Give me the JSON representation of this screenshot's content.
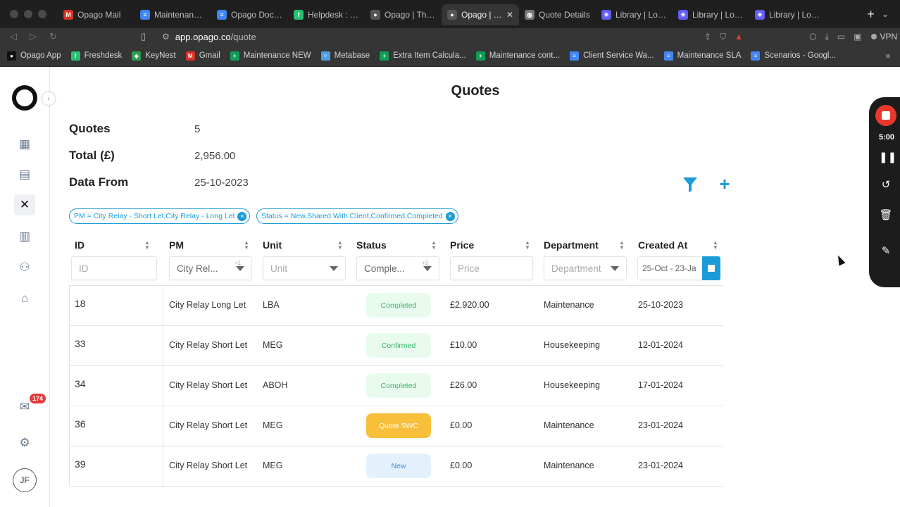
{
  "browser": {
    "tabs": [
      {
        "title": "Opago Mail",
        "icon": "gmail-icon",
        "color": "#d93025",
        "glyph": "M"
      },
      {
        "title": "Maintenance D",
        "icon": "google-docs-icon",
        "color": "#4285f4",
        "glyph": "≡"
      },
      {
        "title": "Opago Docs -",
        "icon": "google-docs-icon",
        "color": "#4285f4",
        "glyph": "≡"
      },
      {
        "title": "Helpdesk : opa",
        "icon": "freshdesk-icon",
        "color": "#25c16f",
        "glyph": "f"
      },
      {
        "title": "Opago | The Pr",
        "icon": "github-icon",
        "color": "#555555",
        "glyph": "●"
      },
      {
        "title": "Opago | Th",
        "icon": "github-icon",
        "color": "#555555",
        "glyph": "●",
        "active": true
      },
      {
        "title": "Quote Details",
        "icon": "globe-icon",
        "color": "#777777",
        "glyph": "◍"
      },
      {
        "title": "Library | Loom",
        "icon": "loom-icon",
        "color": "#625df5",
        "glyph": "✳"
      },
      {
        "title": "Library | Loom",
        "icon": "loom-icon",
        "color": "#625df5",
        "glyph": "✳"
      },
      {
        "title": "Library | Loom",
        "icon": "loom-icon",
        "color": "#625df5",
        "glyph": "✳"
      }
    ],
    "url_host": "app.opago.co",
    "url_path": "/quote",
    "vpn_label": "VPN",
    "bookmarks": [
      {
        "title": "Opago App",
        "color": "#111111",
        "glyph": "●"
      },
      {
        "title": "Freshdesk",
        "color": "#25c16f",
        "glyph": "f"
      },
      {
        "title": "KeyNest",
        "color": "#2e9e4f",
        "glyph": "◆"
      },
      {
        "title": "Gmail",
        "color": "#d93025",
        "glyph": "M"
      },
      {
        "title": "Maintenance NEW",
        "color": "#0f9d58",
        "glyph": "+"
      },
      {
        "title": "Metabase",
        "color": "#509ee3",
        "glyph": "⁘"
      },
      {
        "title": "Extra Item Calcula...",
        "color": "#0f9d58",
        "glyph": "+"
      },
      {
        "title": "Maintenance cont...",
        "color": "#0f9d58",
        "glyph": "+"
      },
      {
        "title": "Client Service Wa...",
        "color": "#4285f4",
        "glyph": "≡"
      },
      {
        "title": "Maintenance SLA",
        "color": "#4285f4",
        "glyph": "≡"
      },
      {
        "title": "Scenarios - Googl...",
        "color": "#4285f4",
        "glyph": "≡"
      }
    ]
  },
  "sidebar": {
    "badge_count": "174",
    "avatar_initials": "JF"
  },
  "page": {
    "title": "Quotes",
    "summary": [
      {
        "label": "Quotes",
        "value": "5"
      },
      {
        "label": "Total (£)",
        "value": "2,956.00"
      },
      {
        "label": "Data From",
        "value": "25-10-2023"
      }
    ],
    "chips": [
      "PM = City Relay - Short Let,City Relay - Long Let",
      "Status = New,Shared With Client,Confirmed,Completed"
    ]
  },
  "table": {
    "columns": [
      "ID",
      "PM",
      "Unit",
      "Status",
      "Price",
      "Department",
      "Created At"
    ],
    "filters": {
      "id_placeholder": "ID",
      "pm_value": "City Rel...",
      "pm_count": "+1",
      "unit_placeholder": "Unit",
      "status_value": "Comple...",
      "status_count": "+3",
      "price_placeholder": "Price",
      "department_placeholder": "Department",
      "created_value": "25-Oct - 23-Ja"
    },
    "rows": [
      {
        "id": "18",
        "pm": "City Relay Long Let",
        "unit": "LBA",
        "status": "Completed",
        "price": "£2,920.00",
        "department": "Maintenance",
        "created": "25-10-2023"
      },
      {
        "id": "33",
        "pm": "City Relay Short Let",
        "unit": "MEG",
        "status": "Confirmed",
        "price": "£10.00",
        "department": "Housekeeping",
        "created": "12-01-2024"
      },
      {
        "id": "34",
        "pm": "City Relay Short Let",
        "unit": "ABOH",
        "status": "Completed",
        "price": "£26.00",
        "department": "Housekeeping",
        "created": "17-01-2024"
      },
      {
        "id": "36",
        "pm": "City Relay Short Let",
        "unit": "MEG",
        "status": "Quote SWC",
        "price": "£0.00",
        "department": "Maintenance",
        "created": "23-01-2024"
      },
      {
        "id": "39",
        "pm": "City Relay Short Let",
        "unit": "MEG",
        "status": "New",
        "price": "£0.00",
        "department": "Maintenance",
        "created": "23-01-2024"
      }
    ]
  },
  "status_colors": {
    "Completed": {
      "bg": "#e9fbef",
      "fg": "#3bb36a"
    },
    "Confirmed": {
      "bg": "#e9fbef",
      "fg": "#3bb36a"
    },
    "Quote SWC": {
      "bg": "#f7bf3a",
      "fg": "#ffffff"
    },
    "New": {
      "bg": "#e3f1fd",
      "fg": "#3a8fd8"
    }
  },
  "loom": {
    "timer": "5:00"
  },
  "colors": {
    "accent": "#1b9bd7"
  }
}
